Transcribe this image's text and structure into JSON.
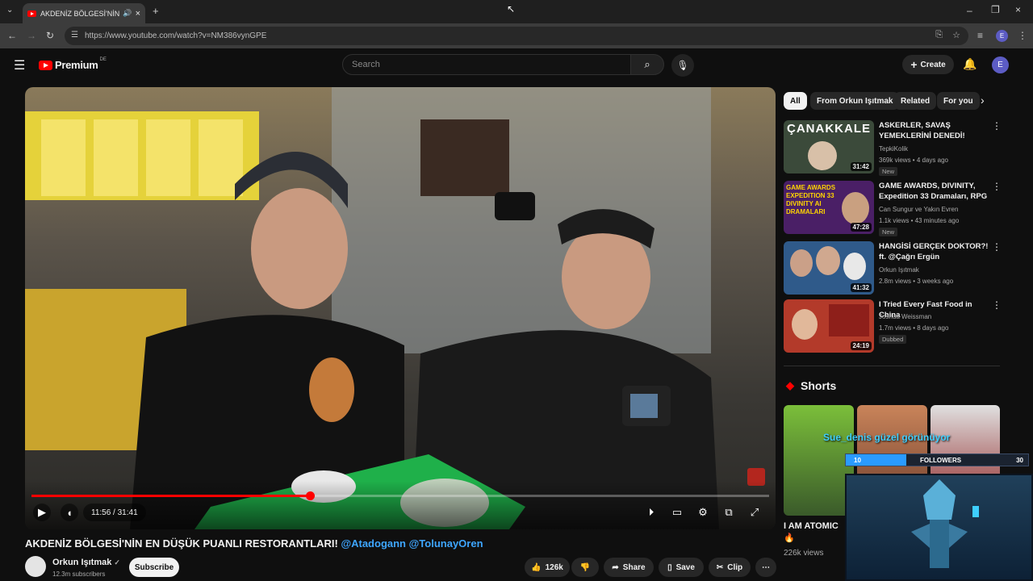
{
  "browser": {
    "tab_title": "AKDENİZ BÖLGESİ'NİN EN",
    "url": "https://www.youtube.com/watch?v=NM386vynGPE",
    "profile_initial": "E"
  },
  "header": {
    "logo": "Premium",
    "region": "DE",
    "search_placeholder": "Search",
    "create_label": "Create",
    "avatar_initial": "E"
  },
  "player": {
    "time": "11:56 / 31:41",
    "progress": 0.377
  },
  "video": {
    "title": "AKDENİZ BÖLGESİ'NİN EN DÜŞÜK PUANLI RESTORANTLARI!",
    "mention1": "@Atadogann",
    "mention2": "@TolunayOren",
    "channel": "Orkun Işıtmak",
    "subscribers": "12.3m subscribers",
    "subscribe_label": "Subscribe",
    "likes": "126k",
    "share_label": "Share",
    "save_label": "Save",
    "clip_label": "Clip"
  },
  "chips": [
    "All",
    "From Orkun Işıtmak",
    "Related",
    "For you"
  ],
  "recommendations": [
    {
      "title": "ASKERLER, SAVAŞ YEMEKLERİNİ DENEDİ!",
      "channel": "TepkiKolik",
      "meta": "369k views • 4 days ago",
      "badge": "New",
      "duration": "31:42",
      "thumb_text": "ÇANAKKALE",
      "thumb_color": "#3b4a3a"
    },
    {
      "title": "GAME AWARDS, DIVINITY, Expedition 33 Dramaları, RPG ...",
      "channel": "Can Sungur ve Yakın Evren",
      "meta": "1.1k views • 43 minutes ago",
      "badge": "New",
      "duration": "47:28",
      "thumb_text": "GAME AWARDS EXPEDITION 33 DIVINITY AI DRAMALARI",
      "thumb_color": "#4a1f66"
    },
    {
      "title": "HANGİSİ GERÇEK DOKTOR?! ft. @Çağrı Ergün",
      "channel": "Orkun Işıtmak",
      "meta": "2.8m views • 3 weeks ago",
      "badge": "",
      "duration": "41:32",
      "thumb_text": "",
      "thumb_color": "#2f5a8a"
    },
    {
      "title": "I Tried Every Fast Food in China",
      "channel": "Joshua Weissman",
      "meta": "1.7m views • 8 days ago",
      "badge": "Dubbed",
      "duration": "24:19",
      "thumb_text": "",
      "thumb_color": "#b33a2a"
    }
  ],
  "shorts": {
    "heading": "Shorts",
    "first_title": "I AM ATOMIC 🔥",
    "first_views": "226k views"
  },
  "overlay": {
    "chat_line": "Sue_denis güzel görünüyor",
    "goal_current": "10",
    "goal_label": "FOLLOWERS",
    "goal_target": "30",
    "goal_fraction": 0.33
  },
  "colors": {
    "accent": "#ff0000",
    "link": "#3ea6ff",
    "bg": "#0f0f0f"
  }
}
